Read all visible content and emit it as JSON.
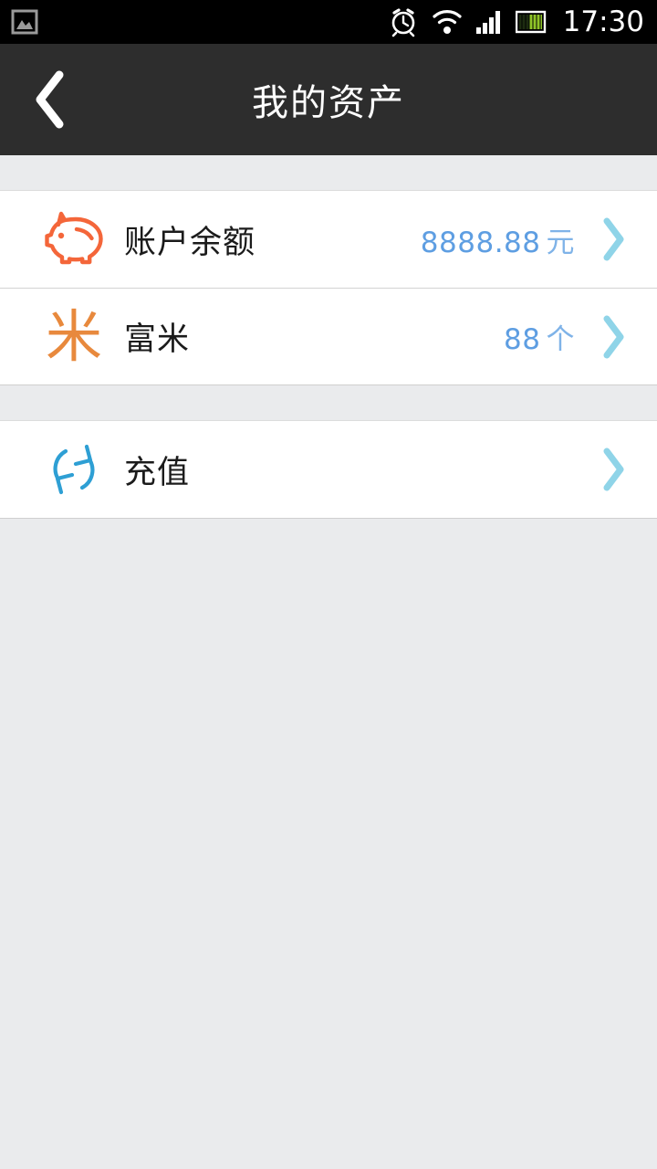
{
  "status_bar": {
    "left_icons": [
      {
        "name": "screenshot-image-icon",
        "glyph": "image"
      }
    ],
    "right_icons": [
      {
        "name": "alarm-clock-icon",
        "glyph": "alarm"
      },
      {
        "name": "wifi-icon",
        "glyph": "wifi"
      },
      {
        "name": "cellular-signal-icon",
        "glyph": "signal"
      },
      {
        "name": "battery-icon",
        "glyph": "battery"
      }
    ],
    "time": "17:30"
  },
  "header": {
    "title": "我的资产",
    "back_icon": "chevron-left-icon",
    "background": "#2d2d2d",
    "title_color": "#ffffff"
  },
  "colors": {
    "page_background": "#eaebed",
    "card_background": "#ffffff",
    "accent_orange": "#f4663a",
    "accent_orange_glyph": "#e8893d",
    "accent_blue": "#2e9fd4",
    "value_blue": "#5e9ee2",
    "chevron_blue": "#8fd4e8",
    "divider": "#d3d3d3",
    "label_text": "#1b1b1b"
  },
  "sections": [
    {
      "name": "assets-section",
      "rows": [
        {
          "name": "account-balance",
          "icon": "piggy-bank-icon",
          "label": "账户余额",
          "value": "8888.88",
          "unit": "元",
          "chevron": "chevron-right-icon"
        },
        {
          "name": "fumi",
          "icon": "mi-grain-icon",
          "icon_glyph": "米",
          "label": "富米",
          "value": "88",
          "unit": "个",
          "chevron": "chevron-right-icon"
        }
      ]
    },
    {
      "name": "recharge-section",
      "rows": [
        {
          "name": "recharge",
          "icon": "refresh-circle-icon",
          "label": "充值",
          "value": "",
          "unit": "",
          "chevron": "chevron-right-icon"
        }
      ]
    }
  ]
}
